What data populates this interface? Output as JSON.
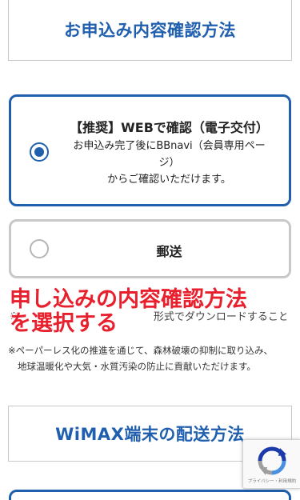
{
  "section1": {
    "title": "お申込み内容確認方法"
  },
  "options": [
    {
      "title": "【推奨】WEBで確認（電子交付）",
      "description_line1": "お申込み完了後にBBnavi（会員専用ペー",
      "description_line2": "ジ）",
      "description_line3": "からご確認いただけます。",
      "selected": true
    },
    {
      "title": "郵送",
      "selected": false
    }
  ],
  "faint_text": "※　　　　　　　　　　　　　形式でダウンロードすることがでさ",
  "overlay": {
    "line1": "申し込みの内容確認方法",
    "line2": "を選択する"
  },
  "note": {
    "line1": "※ペーパーレス化の推進を通じて、森林破壊の抑制に取り込み、",
    "line2": "地球温暖化や大気・水質汚染の防止に貢献いただけます。"
  },
  "section2": {
    "title": "WiMAX端末の配送方法"
  },
  "recaptcha": {
    "privacy_text": "プライバシー・利用規約"
  },
  "colors": {
    "accent": "#1f5fae",
    "overlay": "#e8202e",
    "border": "#c8c8c8"
  }
}
